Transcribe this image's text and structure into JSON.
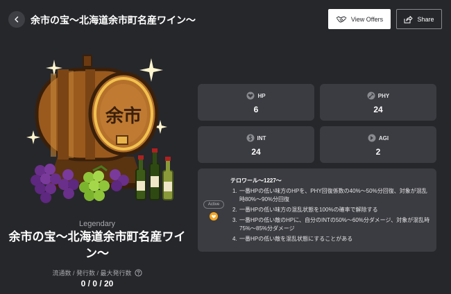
{
  "header": {
    "title": "余市の宝〜北海道余市町名産ワイン〜",
    "view_offers_label": "View Offers",
    "share_label": "Share"
  },
  "item": {
    "barrel_text": "余市",
    "rarity": "Legendary",
    "name": "余市の宝〜北海道余市町名産ワイン〜",
    "supply_label": "流通数 / 発行数 / 最大発行数",
    "supply_value": "0 / 0 / 20"
  },
  "stats": [
    {
      "label": "HP",
      "value": "6",
      "icon": "hp-icon"
    },
    {
      "label": "PHY",
      "value": "24",
      "icon": "phy-icon"
    },
    {
      "label": "INT",
      "value": "24",
      "icon": "int-icon"
    },
    {
      "label": "AGI",
      "value": "2",
      "icon": "agi-icon"
    }
  ],
  "skill": {
    "badge": "Active",
    "title": "テロワール〜1227〜",
    "items": [
      {
        "num": "1.",
        "text": "一番HPの低い味方のHPを、PHY回復係数の40%〜50%分回復、対象が混乱時80%〜90%分回復"
      },
      {
        "num": "2.",
        "text": "一番HPの低い味方の混乱状態を100%の確率で解除する"
      },
      {
        "num": "3.",
        "text": "一番HPの低い敵のHPに、自分のINTの50%〜60%分ダメージ、対象が混乱時75%〜85%分ダメージ"
      },
      {
        "num": "4.",
        "text": "一番HPの低い敵を混乱状態にすることがある"
      }
    ]
  },
  "colors": {
    "background": "#26272b",
    "card": "#3b3c41",
    "accent_orange": "#f5a623"
  }
}
